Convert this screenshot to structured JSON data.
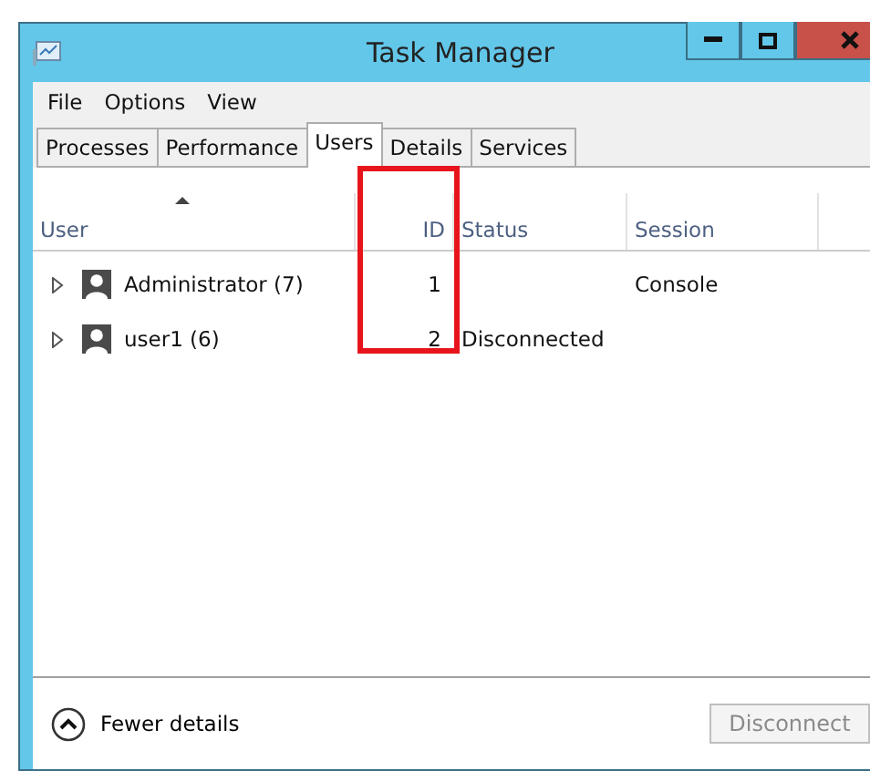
{
  "window": {
    "title": "Task Manager",
    "buttons": [
      {
        "kind": "minimize"
      },
      {
        "kind": "maximize"
      },
      {
        "kind": "close"
      }
    ]
  },
  "menu": [
    "File",
    "Options",
    "View"
  ],
  "tabs": [
    {
      "label": "Processes",
      "selected": false
    },
    {
      "label": "Performance",
      "selected": false
    },
    {
      "label": "Users",
      "selected": true
    },
    {
      "label": "Details",
      "selected": false
    },
    {
      "label": "Services",
      "selected": false
    }
  ],
  "table": {
    "columns": [
      {
        "label": "User",
        "sorted": true
      },
      {
        "label": "ID",
        "sorted": false
      },
      {
        "label": "Status",
        "sorted": false
      },
      {
        "label": "Session",
        "sorted": false
      }
    ],
    "rows": [
      {
        "user": "Administrator (7)",
        "id": "1",
        "status": "",
        "session": "Console",
        "expanded": false
      },
      {
        "user": "user1 (6)",
        "id": "2",
        "status": "Disconnected",
        "session": "",
        "expanded": false
      }
    ]
  },
  "footer": {
    "toggle": "Fewer details",
    "button": {
      "label": "Disconnect",
      "disabled": true
    }
  }
}
